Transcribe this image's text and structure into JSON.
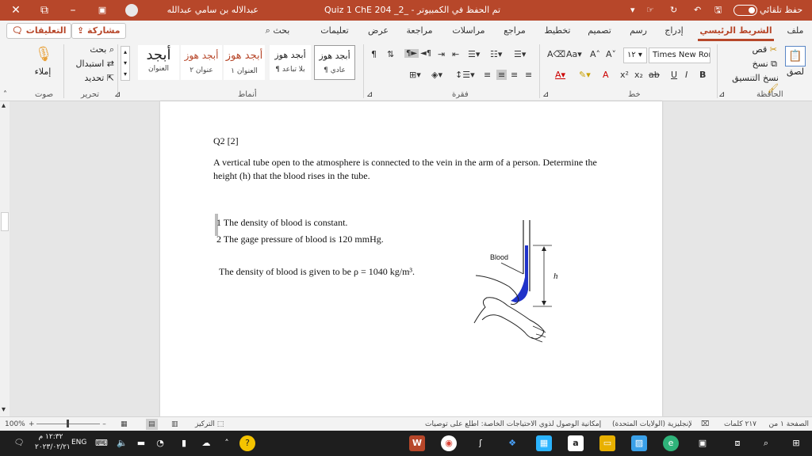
{
  "titlebar": {
    "autosave_label": "حفظ تلقائي",
    "doc_title": "Quiz 1 ChE 204 _2_  -  تم الحفظ في الكمبيوتر الشخصي هذا",
    "user_name": "عبدالاله بن سامي عبدالله العبادي",
    "minimize": "–",
    "restore": "⧉",
    "close": "✕"
  },
  "tabs": {
    "file": "ملف",
    "home": "الشريط الرئيسي",
    "insert": "إدراج",
    "draw": "رسم",
    "design": "تصميم",
    "layout": "تخطيط",
    "references": "مراجع",
    "mailings": "مراسلات",
    "review": "مراجعة",
    "view": "عرض",
    "help": "تعليمات",
    "search": "بحث",
    "share": "مشاركة",
    "comments": "التعليقات"
  },
  "ribbon": {
    "clipboard": {
      "paste": "لصق",
      "cut": "قص",
      "copy": "نسخ",
      "format_painter": "نسخ التنسيق",
      "label": "الحافظة"
    },
    "font": {
      "name": "Times New Roma",
      "size": "١٢",
      "bold": "B",
      "italic": "I",
      "underline": "U",
      "strike": "ab",
      "subscript": "x₂",
      "superscript": "x²",
      "label": "خط"
    },
    "paragraph": {
      "label": "فقرة"
    },
    "styles": {
      "items": [
        {
          "preview": "أبجد هوز",
          "name": "¶ عادي"
        },
        {
          "preview": "أبجد هوز",
          "name": "¶ بلا تباعد"
        },
        {
          "preview": "أبجد هوز",
          "name": "العنوان ١"
        },
        {
          "preview": "أبجد هوز",
          "name": "عنوان ٢"
        },
        {
          "preview": "أبجد",
          "name": "العنوان"
        }
      ],
      "label": "أنماط"
    },
    "editing": {
      "find": "بحث",
      "replace": "استبدال",
      "select": "تحديد",
      "label": "تحرير"
    },
    "voice": {
      "dictate": "إملاء",
      "label": "صوت"
    }
  },
  "document": {
    "q_title": "Q2 [2]",
    "paragraph": "A vertical tube open to the atmosphere is connected to the vein in the arm of a person. Determine the height (h) that the blood rises in the tube.",
    "item1": "1 The density of blood is constant.",
    "item2": "2 The gage pressure of blood is 120 mmHg.",
    "density_text": "The density of blood is given to be ρ = 1040 kg/m³.",
    "fig_blood": "Blood",
    "fig_h": "h"
  },
  "statusbar": {
    "page": "الصفحة ١ من ٢",
    "words": "٢١٧ كلمات",
    "language": "الإنجليزية (الولايات المتحدة)",
    "accessibility": "إمكانية الوصول لذوي الاحتياجات الخاصة: اطلع على توصيات",
    "focus": "التركيز",
    "zoom": "100%"
  },
  "taskbar": {
    "time": "١٢:٣٢ م",
    "date": "٢٠٢٣/٠٢/٢١",
    "lang": "ENG"
  },
  "colors": {
    "accent": "#b7472a",
    "blood": "#1f32c9"
  }
}
